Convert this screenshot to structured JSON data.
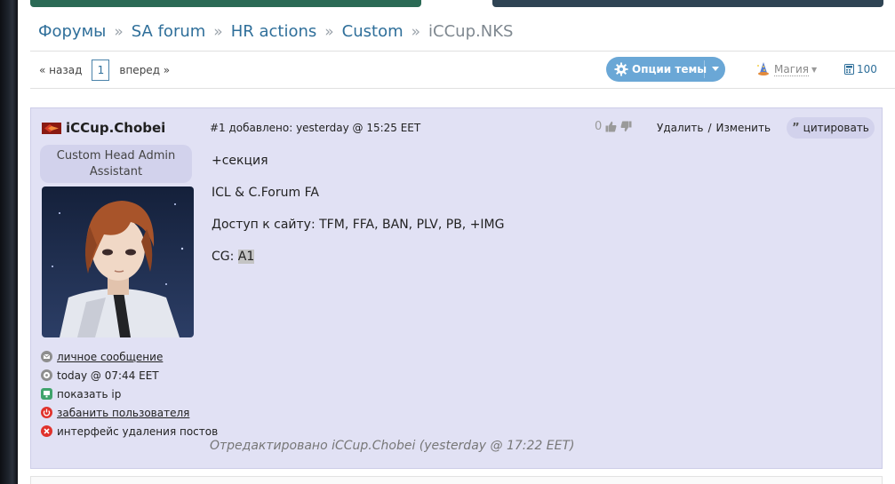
{
  "breadcrumb": {
    "items": [
      "Форумы",
      "SA forum",
      "HR actions",
      "Custom"
    ],
    "separator": "»",
    "current": "iCCup.NKS"
  },
  "pager": {
    "prev": "« назад",
    "page": "1",
    "next": "вперед »"
  },
  "toolbar": {
    "options_label": "Опции темы",
    "magic_label": "Магия",
    "count": "100"
  },
  "post": {
    "author": "iCCup.Chobei",
    "role": "Custom Head Admin Assistant",
    "meta": "#1 добавлено: yesterday @ 15:25 EET",
    "score": "0",
    "delete_label": "Удалить",
    "edit_label": "Изменить",
    "action_separator": "/",
    "quote_label": "цитировать",
    "body": {
      "line1": "+секция",
      "line2": "ICL & C.Forum FA",
      "line3": "Доступ к сайту: TFM, FFA, BAN, PLV, PB, +IMG",
      "line4_prefix": "CG: ",
      "line4_highlight": "A1"
    },
    "user_links": [
      {
        "label": "личное сообщение"
      },
      {
        "label": "today @ 07:44 EET"
      },
      {
        "label": "показать ip"
      },
      {
        "label": "забанить пользователя"
      },
      {
        "label": "интерфейс удаления постов"
      }
    ],
    "edited_note": "Отредактировано iCCup.Chobei (yesterday @ 17:22 EET)"
  },
  "colors": {
    "link": "#2f6f9a",
    "post_bg": "#e1e1f4",
    "button_blue": "#6aa7d6",
    "topbar_green": "#2b6a55",
    "topbar_slate": "#2f4454"
  },
  "icons": [
    "star-icon",
    "globe-icon",
    "gear-icon",
    "chevron-down-icon",
    "wizard-icon",
    "calculator-icon",
    "flag-icon",
    "thumbs-up-icon",
    "thumbs-down-icon",
    "quote-icon",
    "envelope-icon",
    "clock-icon",
    "monitor-icon",
    "power-icon",
    "close-icon"
  ]
}
